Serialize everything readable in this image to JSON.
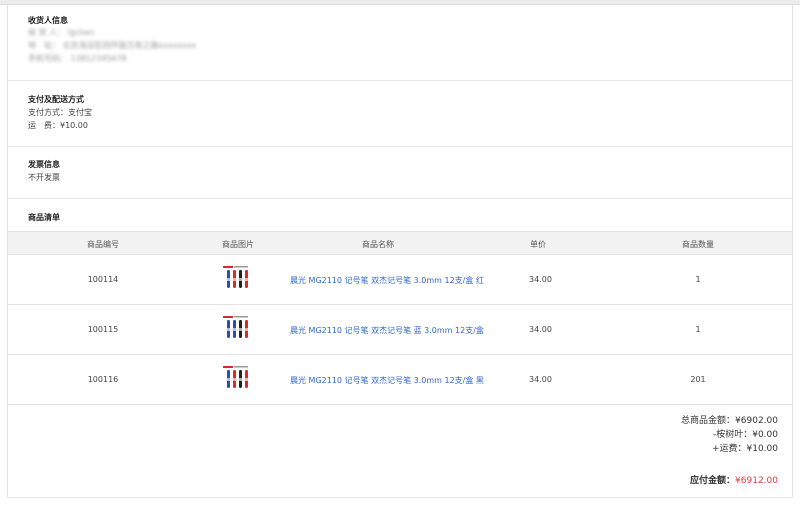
{
  "recipient": {
    "title": "收货人信息",
    "name": "收 货 人： lgchen",
    "address": "地　址： 北京海淀区四环路万寿之路xxxxxxxx",
    "phone": "手机号码： 13812345678"
  },
  "payment": {
    "title": "支付及配送方式",
    "method": "支付方式：支付宝",
    "freight": "运　费：¥10.00"
  },
  "invoice": {
    "title": "发票信息",
    "value": "不开发票"
  },
  "goods": {
    "title": "商品清单",
    "headers": [
      "商品编号",
      "商品图片",
      "商品名称",
      "单价",
      "商品数量"
    ],
    "rows": [
      {
        "id": "100114",
        "name": "晨光 MG2110 记号笔 双杰记号笔 3.0mm 12支/盒 红",
        "price": "34.00",
        "qty": "1"
      },
      {
        "id": "100115",
        "name": "晨光 MG2110 记号笔 双杰记号笔 蓝 3.0mm 12支/盒",
        "price": "34.00",
        "qty": "1"
      },
      {
        "id": "100116",
        "name": "晨光 MG2110 记号笔 双杰记号笔 3.0mm 12支/盒 黑",
        "price": "34.00",
        "qty": "201"
      }
    ],
    "image_icon": "pen-set-image",
    "colors": {
      "red": "#d62b2b",
      "blue": "#2b4fb0",
      "black": "#222222",
      "link": "#3366cc"
    }
  },
  "summary": {
    "total_goods": "总商品金额：¥6902.00",
    "leaf": "-桉树叶：¥0.00",
    "freight": "+运费：¥10.00",
    "payable_label": "应付金额：",
    "payable_value": "¥6912.00",
    "payable_color": "#e4393c"
  }
}
